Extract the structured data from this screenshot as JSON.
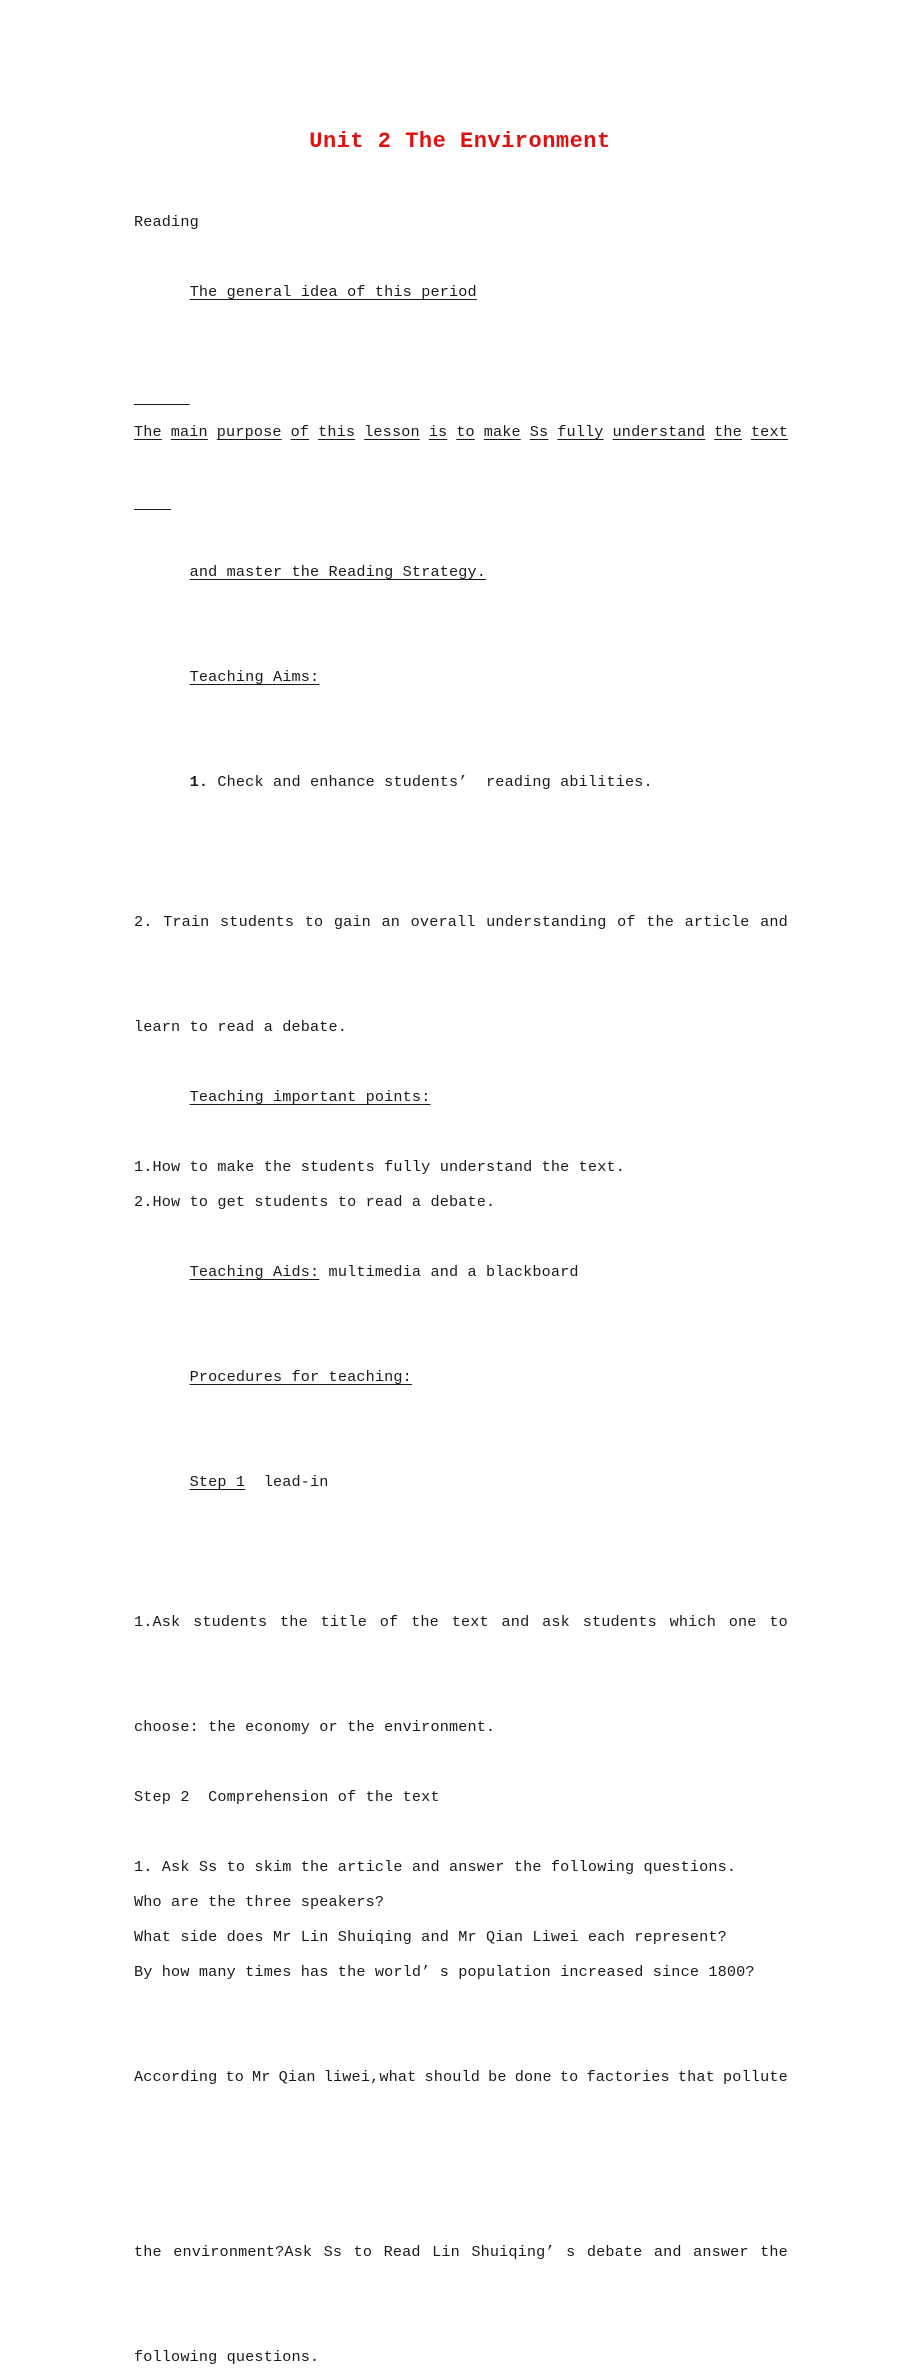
{
  "document": {
    "title": "Unit 2 The Environment",
    "title_color": "#e01010",
    "section_label": "Reading",
    "general_idea_heading": "The general idea of this period",
    "general_idea_line1_words": [
      "The",
      "main",
      "purpose",
      "of",
      "this",
      "lesson",
      "is",
      "to",
      "make",
      "Ss",
      "fully",
      "understand",
      "the",
      "text"
    ],
    "general_idea_line2": "and master the Reading Strategy.",
    "teaching_aims_heading": "Teaching Aims:",
    "aim1_number": "1.",
    "aim1_text": " Check and enhance students’  reading abilities.",
    "aim2_number": "2.",
    "aim2_line1_words": [
      "Train",
      "students",
      "to",
      "gain",
      "an",
      "overall",
      "understanding",
      "of",
      "the",
      "article",
      "and"
    ],
    "aim2_line2": "learn to read a debate.",
    "important_points_heading": "Teaching important points:",
    "important_point_1": "1.How to make the students fully understand the text.",
    "important_point_2": "2.How to get students to read a debate.",
    "teaching_aids_heading": "Teaching Aids:",
    "teaching_aids_text": " multimedia and a blackboard",
    "procedures_heading": "Procedures for teaching:",
    "step1_label": "Step 1",
    "step1_text": "  lead-in",
    "step1_item_line1_words": [
      "1.Ask",
      "students",
      "the",
      "title",
      "of",
      "the",
      "text",
      "and",
      "ask",
      "students",
      "which",
      "one",
      "to"
    ],
    "step1_item_line2": "choose: the economy or the environment.",
    "step2_line": "Step 2  Comprehension of the text",
    "comprehension_item_1": "1. Ask Ss to skim the article and answer the following questions.",
    "questions": [
      "Who are the three speakers?",
      "What side does Mr Lin Shuiqing and Mr Qian Liwei each represent?",
      "By how many times has the world’ s population increased since 1800?"
    ],
    "final_para_line1_words": [
      "According",
      "to",
      "Mr",
      "Qian",
      "liwei,what",
      "should",
      "be",
      "done",
      "to",
      "factories",
      "that",
      "pollute"
    ],
    "final_para_line2_words": [
      "the",
      "environment?Ask",
      "Ss",
      "to",
      "Read",
      "Lin",
      "Shuiqing’",
      "s",
      "debate",
      "and",
      "answer",
      "the"
    ],
    "final_para_line3": "following questions."
  }
}
